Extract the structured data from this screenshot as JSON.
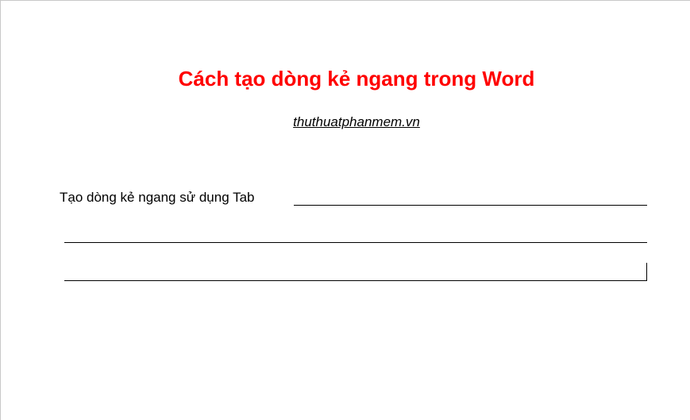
{
  "document": {
    "title": "Cách tạo dòng kẻ ngang trong Word",
    "subtitle": "thuthuatphanmem.vn",
    "line1_text": "Tạo dòng kẻ ngang sử dụng Tab"
  },
  "colors": {
    "title": "#ff0000",
    "text": "#000000",
    "background": "#ffffff"
  }
}
